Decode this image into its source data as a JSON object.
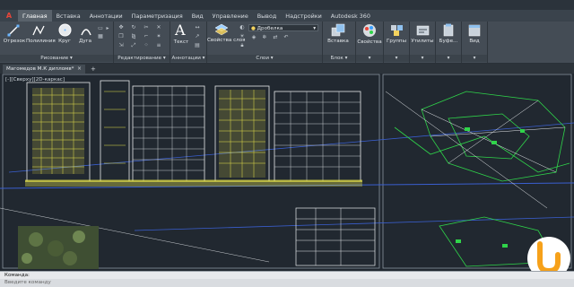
{
  "app": {
    "button_glyph": "A"
  },
  "ribbon_tabs": [
    "Главная",
    "Вставка",
    "Аннотации",
    "Параметризация",
    "Вид",
    "Управление",
    "Вывод",
    "Надстройки",
    "Autodesk 360"
  ],
  "ribbon_active_tab": "Главная",
  "panels": {
    "draw": {
      "title": "Рисование",
      "tools": [
        "Отрезок",
        "Полилиния",
        "Круг",
        "Дуга"
      ]
    },
    "modify": {
      "title": "Редактирование"
    },
    "annotation": {
      "title": "Аннотации",
      "tools": [
        "Текст"
      ]
    },
    "layers": {
      "title": "Слои",
      "tools": [
        "Свойства слоя"
      ],
      "current_layer": "Дробелка"
    },
    "block": {
      "title": "Блок",
      "tools": [
        "Вставка"
      ]
    },
    "properties": {
      "title": "",
      "tools": [
        "Свойства"
      ]
    },
    "groups": {
      "title": "",
      "tools": [
        "Группы"
      ]
    },
    "utilities": {
      "title": "",
      "tools": [
        "Утилиты"
      ]
    },
    "clipboard": {
      "title": "",
      "tools": [
        "Буфе..."
      ]
    },
    "view": {
      "title": "",
      "tools": [
        "Вид"
      ]
    }
  },
  "document_tab": {
    "title": "Магомедов М.К дипломв*",
    "close_glyph": "×",
    "add_glyph": "+"
  },
  "viewport": {
    "label": "[-][Сверху][2D-каркас]"
  },
  "command": {
    "label": "Команда:",
    "placeholder": "Введите команду"
  },
  "colors": {
    "accent": "#e8463a",
    "background": "#212830",
    "ribbon": "#444c55",
    "drawing_yellow": "#e8e44a",
    "drawing_green": "#2fd44a",
    "logo_orange": "#f6a11a"
  },
  "icons": [
    "line-icon",
    "polyline-icon",
    "circle-icon",
    "arc-icon",
    "text-icon",
    "layer-properties-icon",
    "insert-icon",
    "properties-icon",
    "groups-icon",
    "utilities-icon",
    "clipboard-icon",
    "view-icon",
    "close-icon",
    "plus-icon",
    "logo-icon"
  ]
}
